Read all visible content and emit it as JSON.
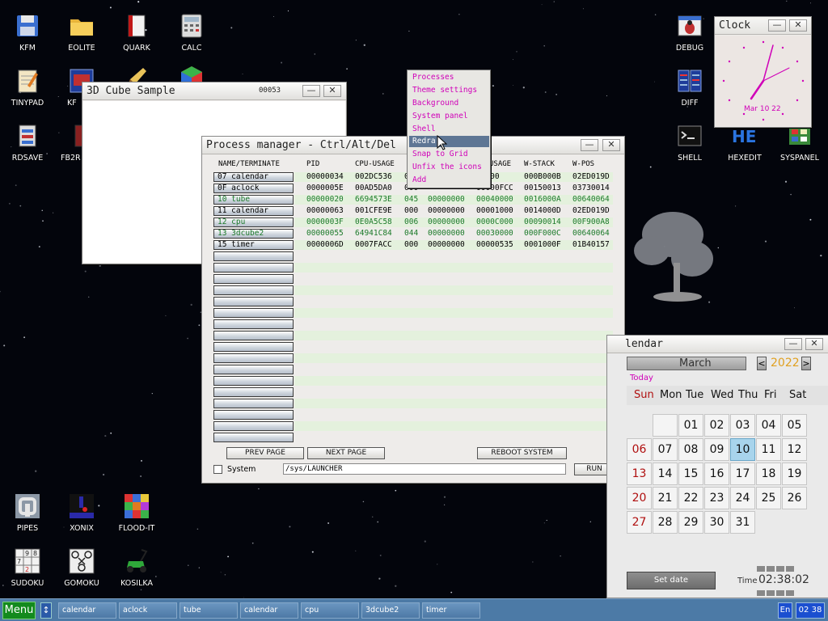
{
  "colors": {
    "desktop": "#03050c",
    "taskbar": "#4c7aa6",
    "menu_button": "#138a1e",
    "menu_text": "#d000b8",
    "menu_highlight": "#5e7694",
    "weekend": "#b01010",
    "today_bg": "#a8d4ec",
    "stripe": "#e4f1dd",
    "green_row": "#1c7a2a"
  },
  "desktop_icons": {
    "kfm": "KFM",
    "eolite": "EOLITE",
    "quark": "QUARK",
    "calc": "CALC",
    "tinypad": "TINYPAD",
    "kf_partial": "KF",
    "rdsave": "RDSAVE",
    "fb2_partial": "FB2R",
    "debug": "DEBUG",
    "diff": "DIFF",
    "shell": "SHELL",
    "hexedit": "HEXEDIT",
    "syspanel": "SYSPANEL",
    "pipes": "PIPES",
    "xonix": "XONIX",
    "floodit": "FLOOD-IT",
    "sudoku": "SUDOKU",
    "gomoku": "GOMOKU",
    "kosilka": "KOSILKA",
    "k_partial": "K"
  },
  "cube_window": {
    "title": "3D Cube Sample",
    "counter": "00053",
    "min": "—",
    "close": "✕"
  },
  "process_manager": {
    "title": "Process manager - Ctrl/Alt/Del",
    "min": "—",
    "close": "✕",
    "columns": [
      "NAME/TERMINATE",
      "PID",
      "CPU-USAGE",
      "RDS",
      "MEM-START",
      "MEM-USAGE",
      "W-STACK",
      "W-POS"
    ],
    "header_visible": {
      "usage": "USAGE"
    },
    "rows": [
      {
        "id": "07",
        "name": "calendar",
        "pid": "00000034",
        "cpu": "002DC536",
        "rds": "0",
        "mem_start": "",
        "mem_usage": "01000",
        "w_stack": "000B000B",
        "w_pos": "02ED019D",
        "green": false
      },
      {
        "id": "0F",
        "name": "aclock",
        "pid": "0000005E",
        "cpu": "00AD5DA0",
        "rds": "000",
        "mem_start": "",
        "mem_usage": "00000FCC",
        "w_stack": "00150013",
        "w_pos": "03730014",
        "green": false
      },
      {
        "id": "10",
        "name": "tube",
        "pid": "00000020",
        "cpu": "6694573E",
        "rds": "045",
        "mem_start": "00000000",
        "mem_usage": "00040000",
        "w_stack": "0016000A",
        "w_pos": "00640064",
        "green": true
      },
      {
        "id": "11",
        "name": "calendar",
        "pid": "00000063",
        "cpu": "001CFE9E",
        "rds": "000",
        "mem_start": "00000000",
        "mem_usage": "00001000",
        "w_stack": "0014000D",
        "w_pos": "02ED019D",
        "green": false
      },
      {
        "id": "12",
        "name": "cpu",
        "pid": "0000003F",
        "cpu": "0E0A5C58",
        "rds": "006",
        "mem_start": "00000000",
        "mem_usage": "0000C000",
        "w_stack": "00090014",
        "w_pos": "00F900A8",
        "green": true
      },
      {
        "id": "13",
        "name": "3dcube2",
        "pid": "00000055",
        "cpu": "64941C84",
        "rds": "044",
        "mem_start": "00000000",
        "mem_usage": "00030000",
        "w_stack": "000F000C",
        "w_pos": "00640064",
        "green": true
      },
      {
        "id": "15",
        "name": "timer",
        "pid": "0000006D",
        "cpu": "0007FACC",
        "rds": "000",
        "mem_start": "00000000",
        "mem_usage": "00000535",
        "w_stack": "0001000F",
        "w_pos": "01B40157",
        "green": false
      }
    ],
    "prev_page": "PREV PAGE",
    "next_page": "NEXT PAGE",
    "reboot": "REBOOT SYSTEM",
    "system_label": "System",
    "path_value": "/sys/LAUNCHER",
    "run": "RUN"
  },
  "context_menu": {
    "items": [
      "Processes",
      "Theme settings",
      "Background",
      "System panel",
      "Shell",
      "Redraw",
      "Snap to Grid",
      "Unfix the icons",
      "Add"
    ],
    "selected_index": 5,
    "visible_labels": {
      "redraw": "Redra"
    }
  },
  "clock": {
    "title": "Clock",
    "date": "Mar 10 22",
    "min": "—",
    "close": "✕"
  },
  "calendar": {
    "title": "lendar",
    "month": "March",
    "year": "2022",
    "today_label": "Today",
    "prev": "<",
    "next": ">",
    "day_names": [
      "Sun",
      "Mon",
      "Tue",
      "Wed",
      "Thu",
      "Fri",
      "Sat"
    ],
    "weeks": [
      [
        "",
        "01",
        "02",
        "03",
        "04",
        "05"
      ],
      [
        "06",
        "07",
        "08",
        "09",
        "10",
        "11",
        "12"
      ],
      [
        "13",
        "14",
        "15",
        "16",
        "17",
        "18",
        "19"
      ],
      [
        "20",
        "21",
        "22",
        "23",
        "24",
        "25",
        "26"
      ],
      [
        "27",
        "28",
        "29",
        "30",
        "31"
      ]
    ],
    "today": "10",
    "set_date": "Set date",
    "time_label": "Time",
    "time_value": "02:38:02",
    "min": "—",
    "close": "✕"
  },
  "taskbar": {
    "menu": "Menu",
    "arrow": "↕",
    "tasks": [
      "calendar",
      "aclock",
      "tube",
      "calendar",
      "cpu",
      "3dcube2",
      "timer"
    ],
    "lang": "En",
    "clock": "02 38"
  }
}
